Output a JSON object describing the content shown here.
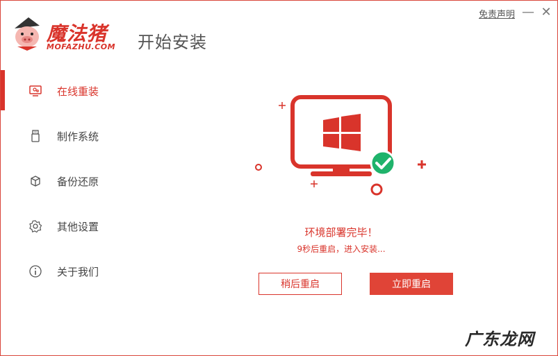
{
  "brand": {
    "name": "魔法猪",
    "sub": "MOFAZHU.COM",
    "accent": "#d9342b"
  },
  "header": {
    "title": "开始安装",
    "disclaimer": "免责声明"
  },
  "window_controls": {
    "minimize_icon": "minimize-icon",
    "close_icon": "close-icon"
  },
  "sidebar": {
    "items": [
      {
        "label": "在线重装",
        "icon": "monitor-icon",
        "active": true
      },
      {
        "label": "制作系统",
        "icon": "usb-icon",
        "active": false
      },
      {
        "label": "备份还原",
        "icon": "backup-icon",
        "active": false
      },
      {
        "label": "其他设置",
        "icon": "gear-icon",
        "active": false
      },
      {
        "label": "关于我们",
        "icon": "info-icon",
        "active": false
      }
    ]
  },
  "main": {
    "status_title": "环境部署完毕！",
    "status_sub": "9秒后重启，进入安装...",
    "btn_later": "稍后重启",
    "btn_now": "立即重启"
  },
  "watermark": "广东龙网"
}
